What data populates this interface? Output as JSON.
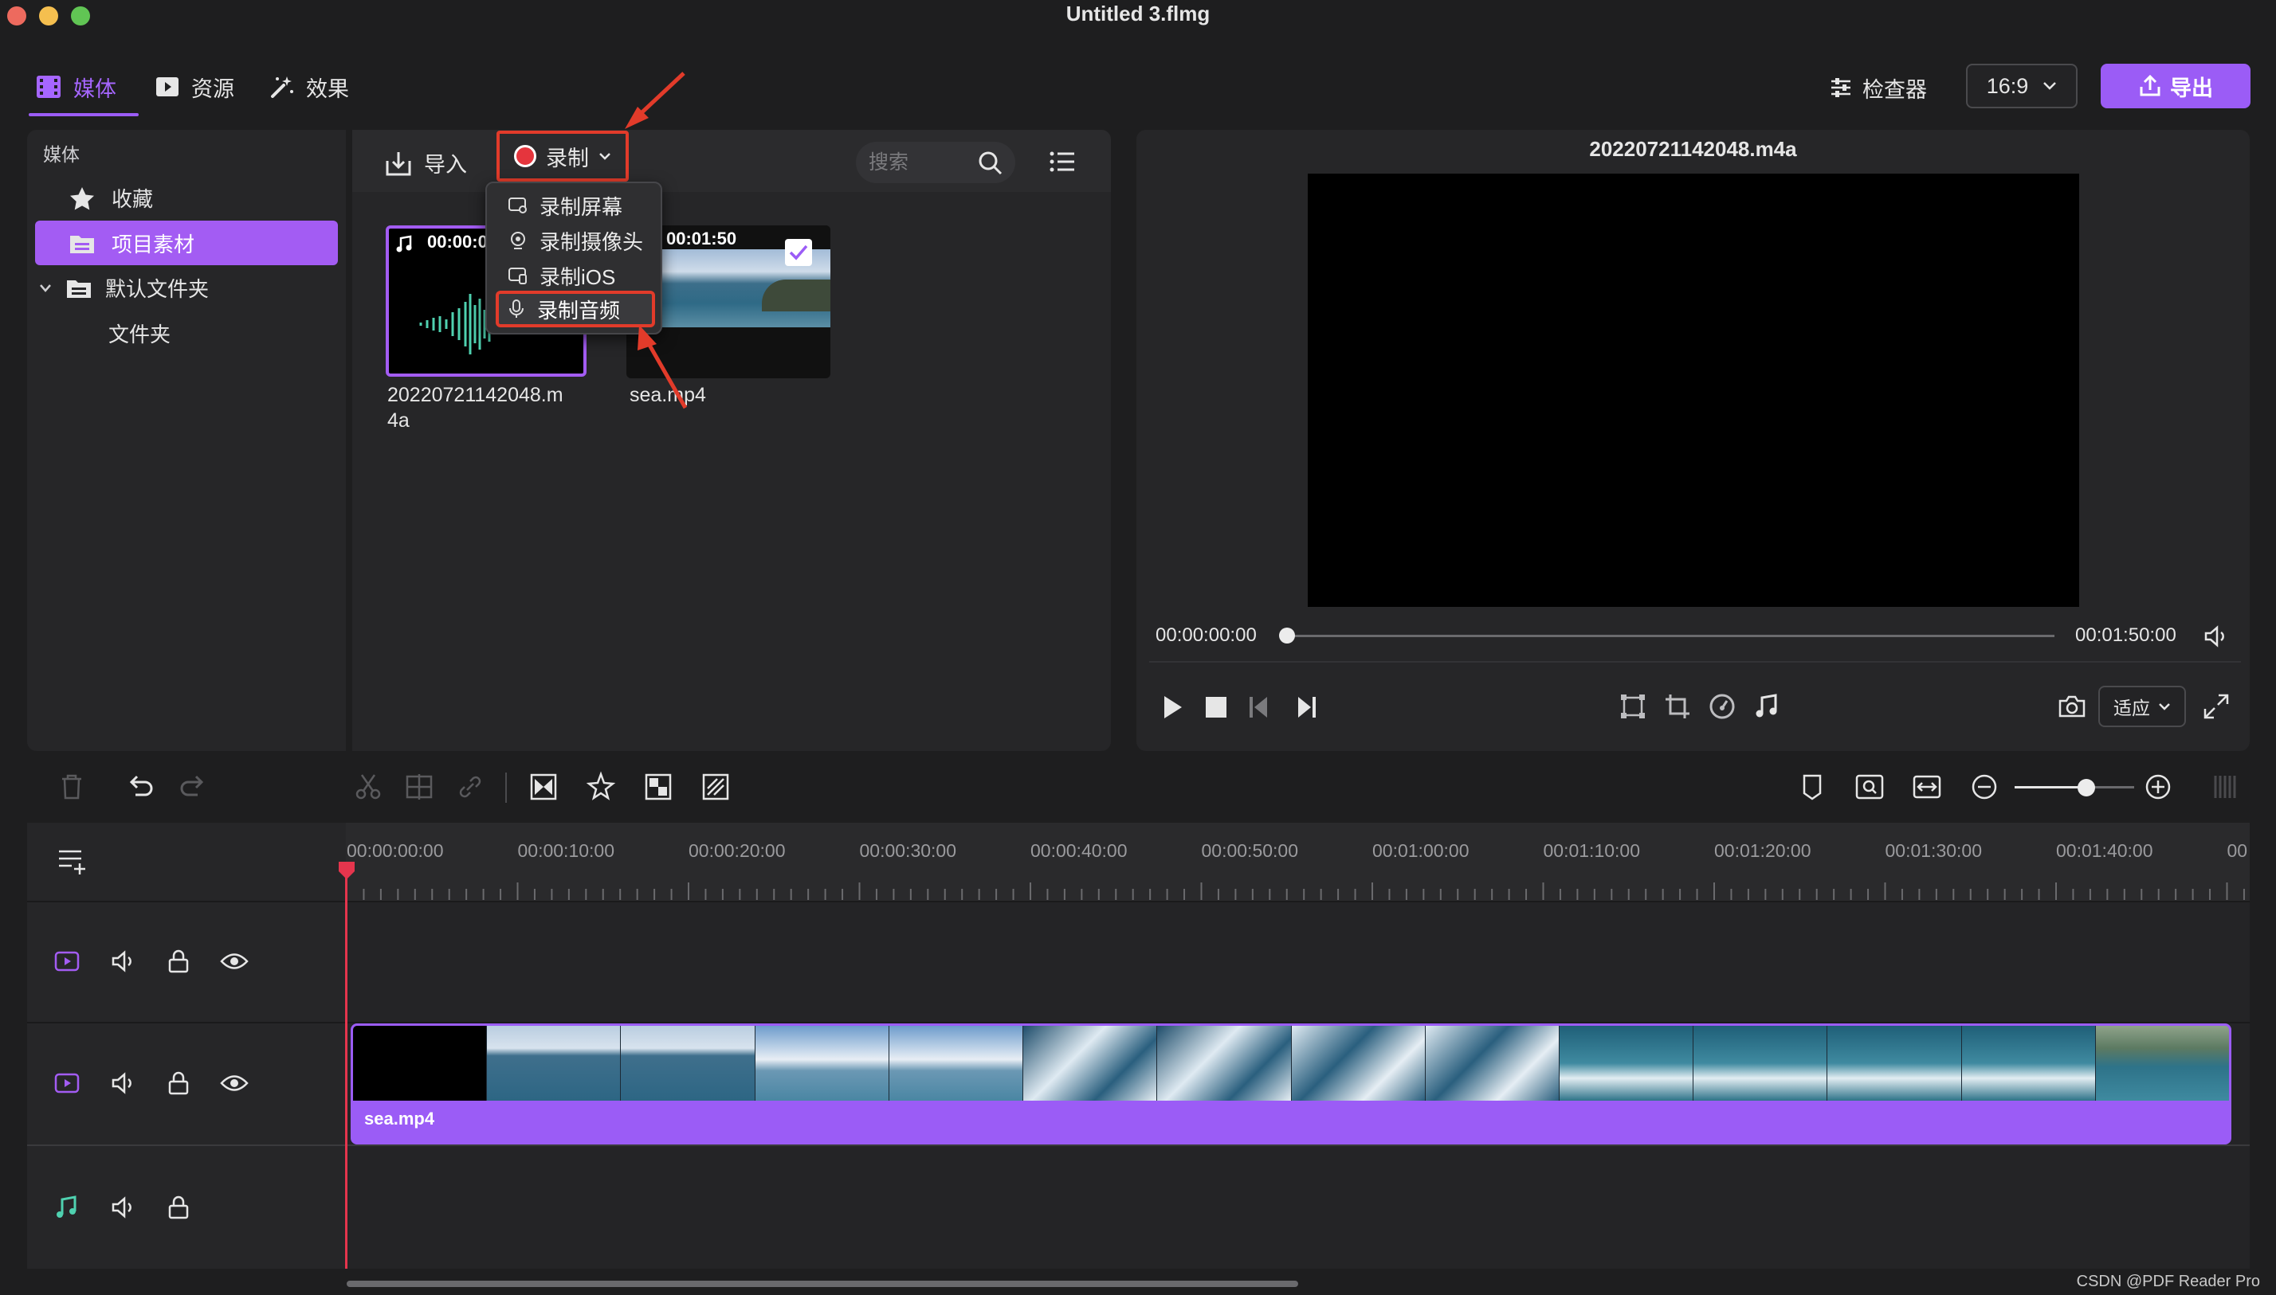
{
  "window": {
    "title": "Untitled 3.flmg"
  },
  "tabs": [
    {
      "label": "媒体",
      "icon": "film-icon",
      "active": true
    },
    {
      "label": "资源",
      "icon": "play-square-icon",
      "active": false
    },
    {
      "label": "效果",
      "icon": "magic-wand-icon",
      "active": false
    }
  ],
  "top_right": {
    "inspector_label": "检查器",
    "aspect_ratio": "16:9",
    "export_label": "导出"
  },
  "sidebar": {
    "header": "媒体",
    "items": [
      {
        "label": "收藏",
        "icon": "star-icon"
      },
      {
        "label": "项目素材",
        "icon": "folder-icon",
        "selected": true
      },
      {
        "label": "默认文件夹",
        "icon": "folder-icon",
        "expanded": true
      },
      {
        "label": "文件夹"
      }
    ]
  },
  "media_toolbar": {
    "import_label": "导入",
    "record_label": "录制",
    "search_placeholder": "搜索"
  },
  "record_menu": {
    "items": [
      {
        "label": "录制屏幕",
        "icon": "screen-record-icon"
      },
      {
        "label": "录制摄像头",
        "icon": "webcam-icon"
      },
      {
        "label": "录制iOS",
        "icon": "ios-device-icon"
      },
      {
        "label": "录制音频",
        "icon": "microphone-icon",
        "highlighted": true
      }
    ]
  },
  "media_items": [
    {
      "name_line1": "20220721142048.m",
      "name_line2": "4a",
      "duration": "00:00:0",
      "type": "audio",
      "selected": true
    },
    {
      "name": "sea.mp4",
      "duration": "00:01:50",
      "type": "video",
      "checked": true
    }
  ],
  "preview": {
    "title": "20220721142048.m4a",
    "current_time": "00:00:00:00",
    "total_time": "00:01:50:00",
    "fit_label": "适应",
    "progress": 0
  },
  "timeline": {
    "ruler_labels": [
      "00:00:00:00",
      "00:00:10:00",
      "00:00:20:00",
      "00:00:30:00",
      "00:00:40:00",
      "00:00:50:00",
      "00:01:00:00",
      "00:01:10:00",
      "00:01:20:00",
      "00:01:30:00",
      "00:01:40:00",
      "00"
    ],
    "clip_label": "sea.mp4"
  },
  "watermark": "CSDN @PDF Reader Pro",
  "colors": {
    "accent": "#9b5cf6",
    "annotation_red": "#e23b2a",
    "playhead": "#e5354d"
  }
}
